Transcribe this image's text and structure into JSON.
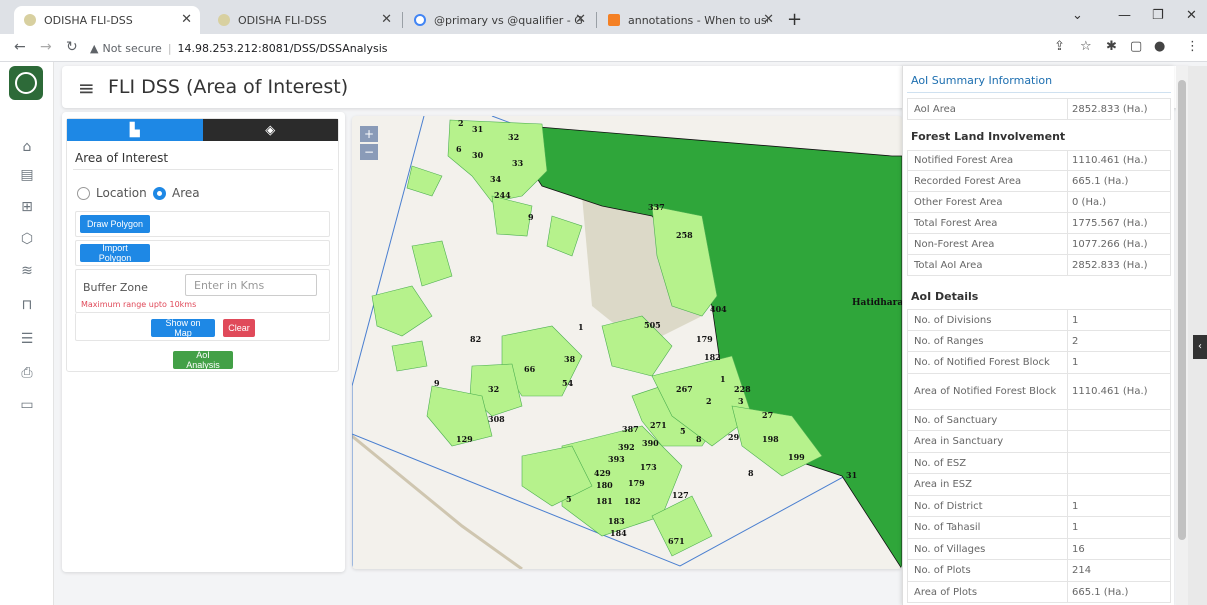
{
  "browser": {
    "tabs": [
      {
        "title": "ODISHA FLI-DSS",
        "active": true
      },
      {
        "title": "ODISHA FLI-DSS",
        "active": false
      },
      {
        "title": "@primary vs @qualifier - Google",
        "active": false
      },
      {
        "title": "annotations - When to use Quali",
        "active": false
      }
    ],
    "new_tab": "+",
    "security_label": "Not secure",
    "url": "14.98.253.212:8081/DSS/DSSAnalysis"
  },
  "app": {
    "title": "FLI DSS (Area of Interest)",
    "rail_icons": [
      "home-icon",
      "document-icon",
      "map-icon",
      "cube-icon",
      "layers-icon",
      "book-icon",
      "database-icon",
      "printer-icon",
      "folder-icon"
    ]
  },
  "aoi_panel": {
    "heading": "Area of Interest",
    "radio_location": "Location",
    "radio_area": "Area",
    "selected_mode": "Area",
    "draw_polygon": "Draw Polygon",
    "import_polygon": "Import Polygon",
    "buffer_label": "Buffer Zone",
    "buffer_placeholder": "Enter in Kms",
    "buffer_hint": "Maximum range upto 10kms",
    "show_on_map": "Show on Map",
    "clear": "Clear",
    "analysis": "AoI Analysis"
  },
  "map": {
    "zoom_in": "+",
    "zoom_out": "−",
    "place_name": "Hatidhara",
    "labels": [
      "2",
      "31",
      "32",
      "6",
      "30",
      "33",
      "34",
      "244",
      "9",
      "337",
      "258",
      "404",
      "505",
      "1",
      "82",
      "179",
      "182",
      "38",
      "66",
      "54",
      "9",
      "32",
      "267",
      "228",
      "1",
      "2",
      "3",
      "27",
      "308",
      "387",
      "271",
      "5",
      "129",
      "390",
      "392",
      "8",
      "29",
      "198",
      "393",
      "199",
      "173",
      "429",
      "180",
      "179",
      "8",
      "31",
      "127",
      "5",
      "181",
      "182",
      "183",
      "184",
      "671"
    ]
  },
  "summary": {
    "title": "AoI Summary Information",
    "aoi_area": {
      "label": "AoI Area",
      "value": "2852.833 (Ha.)"
    },
    "forest_heading": "Forest Land Involvement",
    "forest_rows": [
      {
        "label": "Notified Forest Area",
        "value": "1110.461 (Ha.)"
      },
      {
        "label": "Recorded Forest Area",
        "value": "665.1 (Ha.)"
      },
      {
        "label": "Other Forest Area",
        "value": "0 (Ha.)"
      },
      {
        "label": "Total Forest Area",
        "value": "1775.567 (Ha.)"
      },
      {
        "label": "Non-Forest Area",
        "value": "1077.266 (Ha.)"
      },
      {
        "label": "Total AoI Area",
        "value": "2852.833 (Ha.)"
      }
    ],
    "details_heading": "AoI Details",
    "detail_rows": [
      {
        "label": "No. of Divisions",
        "value": "1"
      },
      {
        "label": "No. of Ranges",
        "value": "2"
      },
      {
        "label": "No. of Notified Forest Block",
        "value": "1"
      },
      {
        "label": "Area of Notified Forest Block",
        "value": "1110.461 (Ha.)"
      },
      {
        "label": "No. of Sanctuary",
        "value": ""
      },
      {
        "label": "Area in Sanctuary",
        "value": ""
      },
      {
        "label": "No. of ESZ",
        "value": ""
      },
      {
        "label": "Area in ESZ",
        "value": ""
      },
      {
        "label": "No. of District",
        "value": "1"
      },
      {
        "label": "No. of Tahasil",
        "value": "1"
      },
      {
        "label": "No. of Villages",
        "value": "16"
      },
      {
        "label": "No. of Plots",
        "value": "214"
      },
      {
        "label": "Area of Plots",
        "value": "665.1 (Ha.)"
      }
    ]
  },
  "colors": {
    "primary_blue": "#1e88e5",
    "forest_dark_green": "#2fa63a",
    "plot_light_green": "#b6f28c",
    "clear_red": "#e04a5a",
    "analysis_green": "#43a047"
  }
}
